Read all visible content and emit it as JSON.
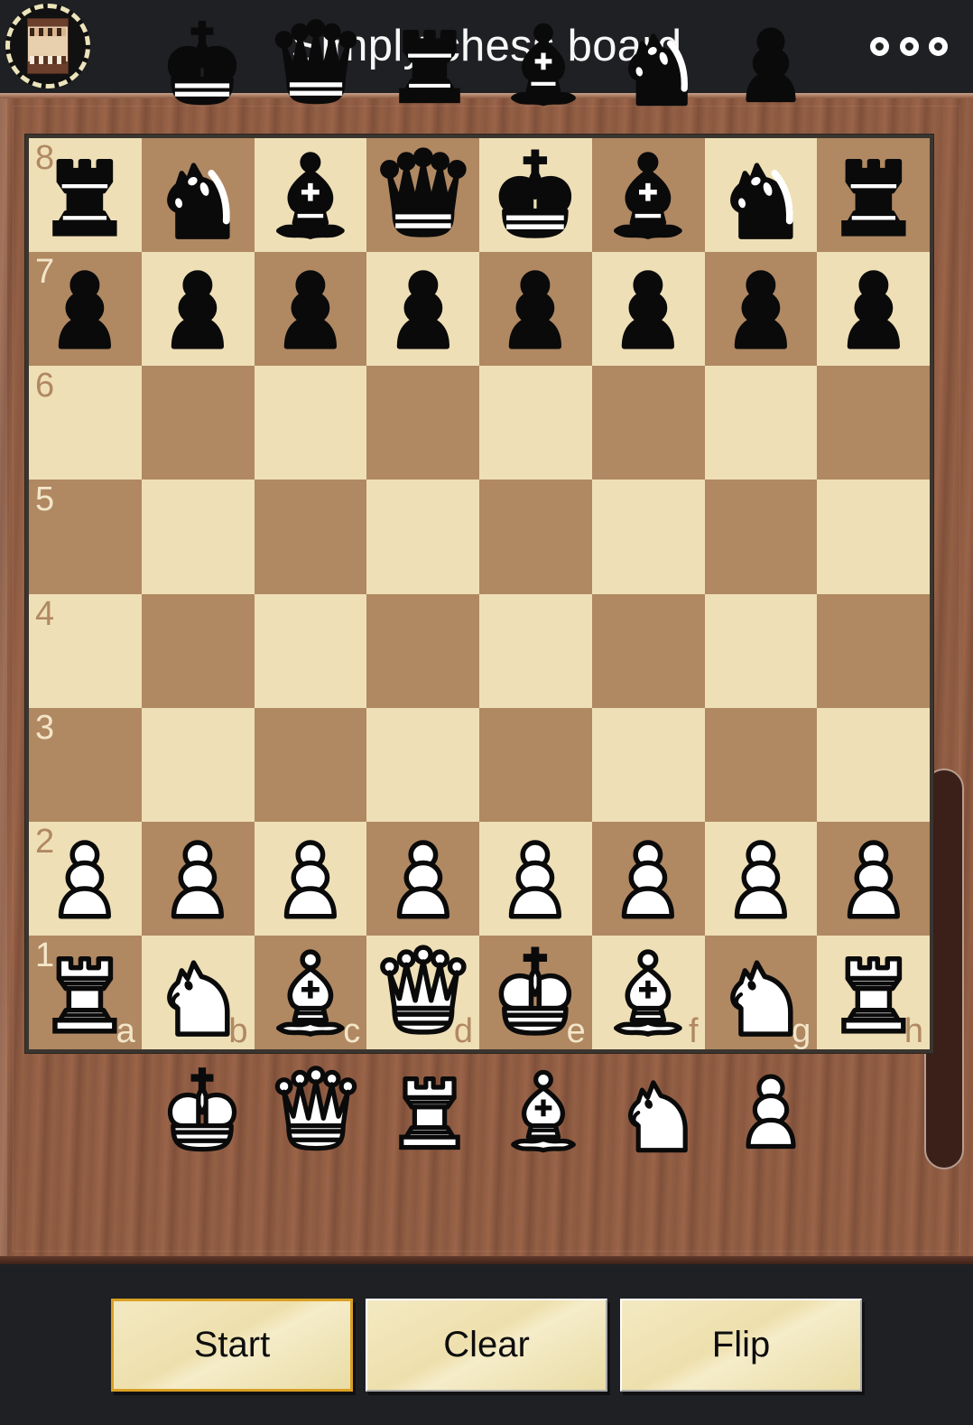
{
  "titlebar": {
    "title": "Simply chess board",
    "app_icon_name": "app-logo-chessboard",
    "overflow_icon_name": "overflow-menu-icon"
  },
  "trays": {
    "top": {
      "color": "black",
      "pieces": [
        {
          "type": "king",
          "label": "black-king"
        },
        {
          "type": "queen",
          "label": "black-queen"
        },
        {
          "type": "rook",
          "label": "black-rook"
        },
        {
          "type": "bishop",
          "label": "black-bishop"
        },
        {
          "type": "knight",
          "label": "black-knight"
        },
        {
          "type": "pawn",
          "label": "black-pawn"
        }
      ]
    },
    "bottom": {
      "color": "white",
      "pieces": [
        {
          "type": "king",
          "label": "white-king"
        },
        {
          "type": "queen",
          "label": "white-queen"
        },
        {
          "type": "rook",
          "label": "white-rook"
        },
        {
          "type": "bishop",
          "label": "white-bishop"
        },
        {
          "type": "knight",
          "label": "white-knight"
        },
        {
          "type": "pawn",
          "label": "white-pawn"
        }
      ]
    }
  },
  "board": {
    "orientation": "white-bottom",
    "files": [
      "a",
      "b",
      "c",
      "d",
      "e",
      "f",
      "g",
      "h"
    ],
    "ranks": [
      "8",
      "7",
      "6",
      "5",
      "4",
      "3",
      "2",
      "1"
    ],
    "position_name": "starting position",
    "rows": [
      [
        {
          "sq": "a8",
          "piece": "rook",
          "color": "black"
        },
        {
          "sq": "b8",
          "piece": "knight",
          "color": "black"
        },
        {
          "sq": "c8",
          "piece": "bishop",
          "color": "black"
        },
        {
          "sq": "d8",
          "piece": "queen",
          "color": "black"
        },
        {
          "sq": "e8",
          "piece": "king",
          "color": "black"
        },
        {
          "sq": "f8",
          "piece": "bishop",
          "color": "black"
        },
        {
          "sq": "g8",
          "piece": "knight",
          "color": "black"
        },
        {
          "sq": "h8",
          "piece": "rook",
          "color": "black"
        }
      ],
      [
        {
          "sq": "a7",
          "piece": "pawn",
          "color": "black"
        },
        {
          "sq": "b7",
          "piece": "pawn",
          "color": "black"
        },
        {
          "sq": "c7",
          "piece": "pawn",
          "color": "black"
        },
        {
          "sq": "d7",
          "piece": "pawn",
          "color": "black"
        },
        {
          "sq": "e7",
          "piece": "pawn",
          "color": "black"
        },
        {
          "sq": "f7",
          "piece": "pawn",
          "color": "black"
        },
        {
          "sq": "g7",
          "piece": "pawn",
          "color": "black"
        },
        {
          "sq": "h7",
          "piece": "pawn",
          "color": "black"
        }
      ],
      [
        {
          "sq": "a6",
          "piece": null,
          "color": null
        },
        {
          "sq": "b6",
          "piece": null,
          "color": null
        },
        {
          "sq": "c6",
          "piece": null,
          "color": null
        },
        {
          "sq": "d6",
          "piece": null,
          "color": null
        },
        {
          "sq": "e6",
          "piece": null,
          "color": null
        },
        {
          "sq": "f6",
          "piece": null,
          "color": null
        },
        {
          "sq": "g6",
          "piece": null,
          "color": null
        },
        {
          "sq": "h6",
          "piece": null,
          "color": null
        }
      ],
      [
        {
          "sq": "a5",
          "piece": null,
          "color": null
        },
        {
          "sq": "b5",
          "piece": null,
          "color": null
        },
        {
          "sq": "c5",
          "piece": null,
          "color": null
        },
        {
          "sq": "d5",
          "piece": null,
          "color": null
        },
        {
          "sq": "e5",
          "piece": null,
          "color": null
        },
        {
          "sq": "f5",
          "piece": null,
          "color": null
        },
        {
          "sq": "g5",
          "piece": null,
          "color": null
        },
        {
          "sq": "h5",
          "piece": null,
          "color": null
        }
      ],
      [
        {
          "sq": "a4",
          "piece": null,
          "color": null
        },
        {
          "sq": "b4",
          "piece": null,
          "color": null
        },
        {
          "sq": "c4",
          "piece": null,
          "color": null
        },
        {
          "sq": "d4",
          "piece": null,
          "color": null
        },
        {
          "sq": "e4",
          "piece": null,
          "color": null
        },
        {
          "sq": "f4",
          "piece": null,
          "color": null
        },
        {
          "sq": "g4",
          "piece": null,
          "color": null
        },
        {
          "sq": "h4",
          "piece": null,
          "color": null
        }
      ],
      [
        {
          "sq": "a3",
          "piece": null,
          "color": null
        },
        {
          "sq": "b3",
          "piece": null,
          "color": null
        },
        {
          "sq": "c3",
          "piece": null,
          "color": null
        },
        {
          "sq": "d3",
          "piece": null,
          "color": null
        },
        {
          "sq": "e3",
          "piece": null,
          "color": null
        },
        {
          "sq": "f3",
          "piece": null,
          "color": null
        },
        {
          "sq": "g3",
          "piece": null,
          "color": null
        },
        {
          "sq": "h3",
          "piece": null,
          "color": null
        }
      ],
      [
        {
          "sq": "a2",
          "piece": "pawn",
          "color": "white"
        },
        {
          "sq": "b2",
          "piece": "pawn",
          "color": "white"
        },
        {
          "sq": "c2",
          "piece": "pawn",
          "color": "white"
        },
        {
          "sq": "d2",
          "piece": "pawn",
          "color": "white"
        },
        {
          "sq": "e2",
          "piece": "pawn",
          "color": "white"
        },
        {
          "sq": "f2",
          "piece": "pawn",
          "color": "white"
        },
        {
          "sq": "g2",
          "piece": "pawn",
          "color": "white"
        },
        {
          "sq": "h2",
          "piece": "pawn",
          "color": "white"
        }
      ],
      [
        {
          "sq": "a1",
          "piece": "rook",
          "color": "white"
        },
        {
          "sq": "b1",
          "piece": "knight",
          "color": "white"
        },
        {
          "sq": "c1",
          "piece": "bishop",
          "color": "white"
        },
        {
          "sq": "d1",
          "piece": "queen",
          "color": "white"
        },
        {
          "sq": "e1",
          "piece": "king",
          "color": "white"
        },
        {
          "sq": "f1",
          "piece": "bishop",
          "color": "white"
        },
        {
          "sq": "g1",
          "piece": "knight",
          "color": "white"
        },
        {
          "sq": "h1",
          "piece": "rook",
          "color": "white"
        }
      ]
    ]
  },
  "buttons": [
    {
      "label": "Start",
      "name": "start-button",
      "selected": true
    },
    {
      "label": "Clear",
      "name": "clear-button",
      "selected": false
    },
    {
      "label": "Flip",
      "name": "flip-button",
      "selected": false
    }
  ],
  "colors": {
    "light_square": "#eedfb6",
    "dark_square": "#b08862",
    "wood_frame": "#8d5a41",
    "titlebar_bg": "#1f2023",
    "button_face": "#eee0ad",
    "selected_border": "#d9a023"
  },
  "scrollbar": {
    "name": "vertical-scroll-handle"
  }
}
